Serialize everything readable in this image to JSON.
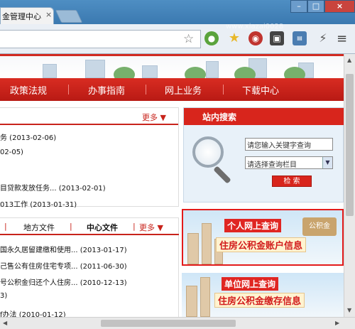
{
  "browser": {
    "tab_title": "金管理中心",
    "tab_close": "×",
    "watermark": "www.xiazai0028",
    "window_min": "–",
    "window_max": "□",
    "window_close": "×",
    "bookmark_star": "☆",
    "menu_icon": "≡"
  },
  "nav": {
    "items": [
      "政策法规",
      "办事指南",
      "网上业务",
      "下载中心"
    ]
  },
  "notice_box": {
    "more_label": "更多 ▼",
    "rows": [
      "务 (2013-02-06)",
      "02-05)",
      "",
      "目贷款发放任务... (2013-02-01)",
      "013工作 (2013-01-31)"
    ]
  },
  "docs_box": {
    "tabs": [
      "地方文件",
      "中心文件"
    ],
    "bar": "|",
    "more_label": "更多 ▼",
    "rows": [
      "国永久居留建缴和使用... (2013-01-17)",
      "己售公有住房住宅专项... (2011-06-30)",
      "号公积金归还个人住房... (2010-12-13)",
      "3)",
      "f办法 (2010-01-12)"
    ]
  },
  "search": {
    "title": "站内搜索",
    "keyword_placeholder": "请您输入关键字查询",
    "column_select": "请选择查询栏目",
    "button_label": "检  索"
  },
  "promos": [
    {
      "line1": "个人网上查询",
      "line2": "住房公积金账户信息",
      "stamp": "公积金"
    },
    {
      "line1": "单位网上查询",
      "line2": "住房公积金缴存信息"
    }
  ],
  "scrollbar": {
    "up": "▲",
    "down": "▼",
    "left": "◀",
    "right": "▶"
  }
}
